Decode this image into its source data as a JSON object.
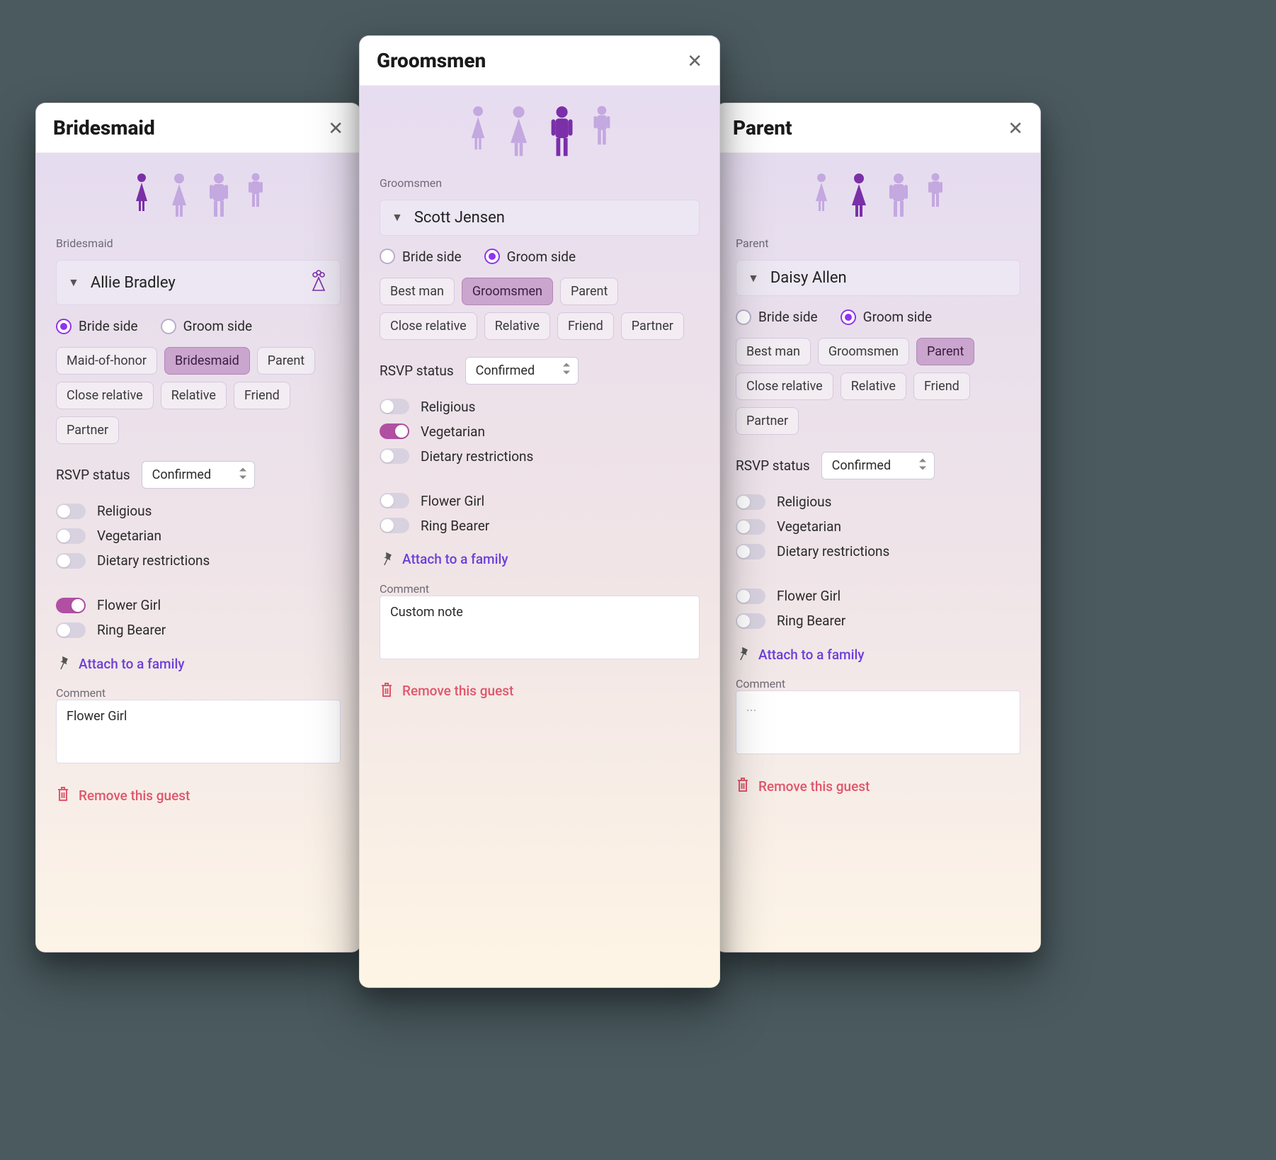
{
  "labels": {
    "bride_side": "Bride side",
    "groom_side": "Groom side",
    "rsvp_status": "RSVP status",
    "religious": "Religious",
    "vegetarian": "Vegetarian",
    "dietary": "Dietary restrictions",
    "flower_girl": "Flower Girl",
    "ring_bearer": "Ring Bearer",
    "attach": "Attach to a family",
    "comment": "Comment",
    "remove": "Remove this guest",
    "comment_placeholder": "..."
  },
  "role_sets": {
    "bride": [
      "Maid-of-honor",
      "Bridesmaid",
      "Parent",
      "Close relative",
      "Relative",
      "Friend",
      "Partner"
    ],
    "groom": [
      "Best man",
      "Groomsmen",
      "Parent",
      "Close relative",
      "Relative",
      "Friend",
      "Partner"
    ]
  },
  "rsvp_value": "Confirmed",
  "cards": {
    "left": {
      "title": "Bridesmaid",
      "role_label": "Bridesmaid",
      "name": "Allie Bradley",
      "side": "bride",
      "role_set": "bride",
      "selected_role": "Bridesmaid",
      "person_index": 0,
      "show_flower_icon": true,
      "toggles": {
        "religious": false,
        "vegetarian": false,
        "dietary": false,
        "flower_girl": true,
        "ring_bearer": false
      },
      "comment": "Flower Girl"
    },
    "front": {
      "title": "Groomsmen",
      "role_label": "Groomsmen",
      "name": "Scott Jensen",
      "side": "groom",
      "role_set": "groom",
      "selected_role": "Groomsmen",
      "person_index": 2,
      "show_flower_icon": false,
      "toggles": {
        "religious": false,
        "vegetarian": true,
        "dietary": false,
        "flower_girl": false,
        "ring_bearer": false
      },
      "comment": "Custom note"
    },
    "right": {
      "title": "Parent",
      "role_label": "Parent",
      "name": "Daisy Allen",
      "side": "groom",
      "role_set": "groom",
      "selected_role": "Parent",
      "person_index": 1,
      "show_flower_icon": false,
      "toggles": {
        "religious": false,
        "vegetarian": false,
        "dietary": false,
        "flower_girl": false,
        "ring_bearer": false
      },
      "comment": ""
    }
  }
}
